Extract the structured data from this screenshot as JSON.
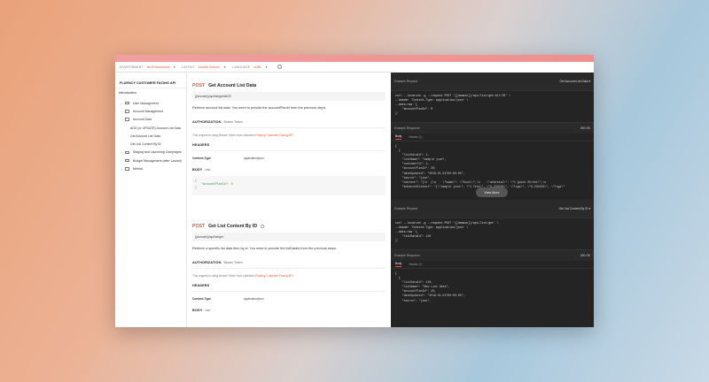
{
  "toolbar": {
    "environment_label": "ENVIRONMENT",
    "environment_value": "No Environment",
    "layout_label": "LAYOUT",
    "layout_value": "Double Column",
    "language_label": "LANGUAGE",
    "language_value": "cURL"
  },
  "sidebar": {
    "title": "FLUENCY CUSTOMER FACING API",
    "introduction": "Introduction",
    "items": [
      {
        "label": "User Management",
        "level": 1
      },
      {
        "label": "Account Management",
        "level": 1
      },
      {
        "label": "Account Data",
        "level": 1
      },
      {
        "label": "ADD (or UPDATE) Account List Data",
        "level": 2
      },
      {
        "label": "Get Account List Data",
        "level": 2
      },
      {
        "label": "Get List Content By ID",
        "level": 2
      },
      {
        "label": "Staging and Launching Campaigns",
        "level": 1
      },
      {
        "label": "Budget Management (after Launch)",
        "level": 1
      },
      {
        "label": "Metrics",
        "level": 1
      }
    ]
  },
  "endpoint1": {
    "method": "POST",
    "title": "Get Account List Data",
    "url": "{{domain}}/api/list/get/all/20",
    "description": "Retrieve account list data. You need to provide the accountPlanId from the previous steps.",
    "auth_title": "AUTHORIZATION",
    "auth_type": "Bearer Token",
    "auth_note_prefix": "This request is using Bearer Token from collection",
    "auth_note_link": "Fluency Customer Facing API",
    "headers_title": "HEADERS",
    "header_key": "Content-Type",
    "header_value": "application/json",
    "body_title": "BODY",
    "body_type": "raw",
    "body_open": "{",
    "body_key": "\"accountPlanId\": ",
    "body_value": "0",
    "body_close": "}"
  },
  "endpoint2": {
    "method": "POST",
    "title": "Get List Content By ID",
    "url": "{{domain}}/api/list/get",
    "description": "Retrieve a specific list data item by id. You need to provide the listDataId from the previous steps.",
    "auth_title": "AUTHORIZATION",
    "auth_type": "Bearer Token",
    "auth_note_prefix": "This request is using Bearer Token from collection",
    "auth_note_link": "Fluency Customer Facing API",
    "headers_title": "HEADERS",
    "header_key": "Content-Type",
    "header_value": "application/json",
    "body_title": "BODY",
    "body_type": "raw"
  },
  "right": {
    "example_request_label": "Example Request",
    "example_response_label": "Example Response",
    "req1_select": "Get Account List Data",
    "req1_code": "curl --location -g --request POST '{{domain}}/api/list/get/all/20' \\\n--header 'Content-Type: application/json' \\\n--data-raw '{\n    \"accountPlanId\": 0\n}'",
    "resp1_status": "200 OK",
    "tab_body": "Body",
    "tab_header": "Header",
    "tab_header_count": "(8)",
    "resp1_code": "{\n  {\n    \"listDataId\": 1,\n    \"listName\": \"sample json\",\n    \"customerId\": 1,\n    \"accountPlanId\": 20,\n    \"dateUpdated\": \"2018-01-01T00:00:00\",\n    \"source\": \"json\",\n    \"content\": \"[\\n  {\\n    \\\"name\\\": \\\"Scott\\\",\\n    \\\"address1\\\": \\\"1 Quick Street\\\",\\n\n    \"enhancedContent\": \"[\\\"sample json\\\", \\\"1 Test\\\", \\\"9-234534\\\", \\\"logs\\\", \\\"8-234234\\\", \\\"logs\\\"",
    "view_more": "View More",
    "req2_select": "Get List Content By ID",
    "req2_code": "curl --location -g --request POST '{{domain}}/api/list/get' \\\n--header 'Content-Type: application/json' \\\n--data-raw '{\n    \"listDataId\": 110\n}'",
    "resp2_status": "200 OK",
    "resp2_code": "{\n  {\n    \"listDataId\": 110,\n    \"listName\": \"New List Data\",\n    \"accountPlanId\": 20,\n    \"dateUpdated\": \"2018-01-01T00:00:00\",\n    \"source\": \"json\","
  }
}
